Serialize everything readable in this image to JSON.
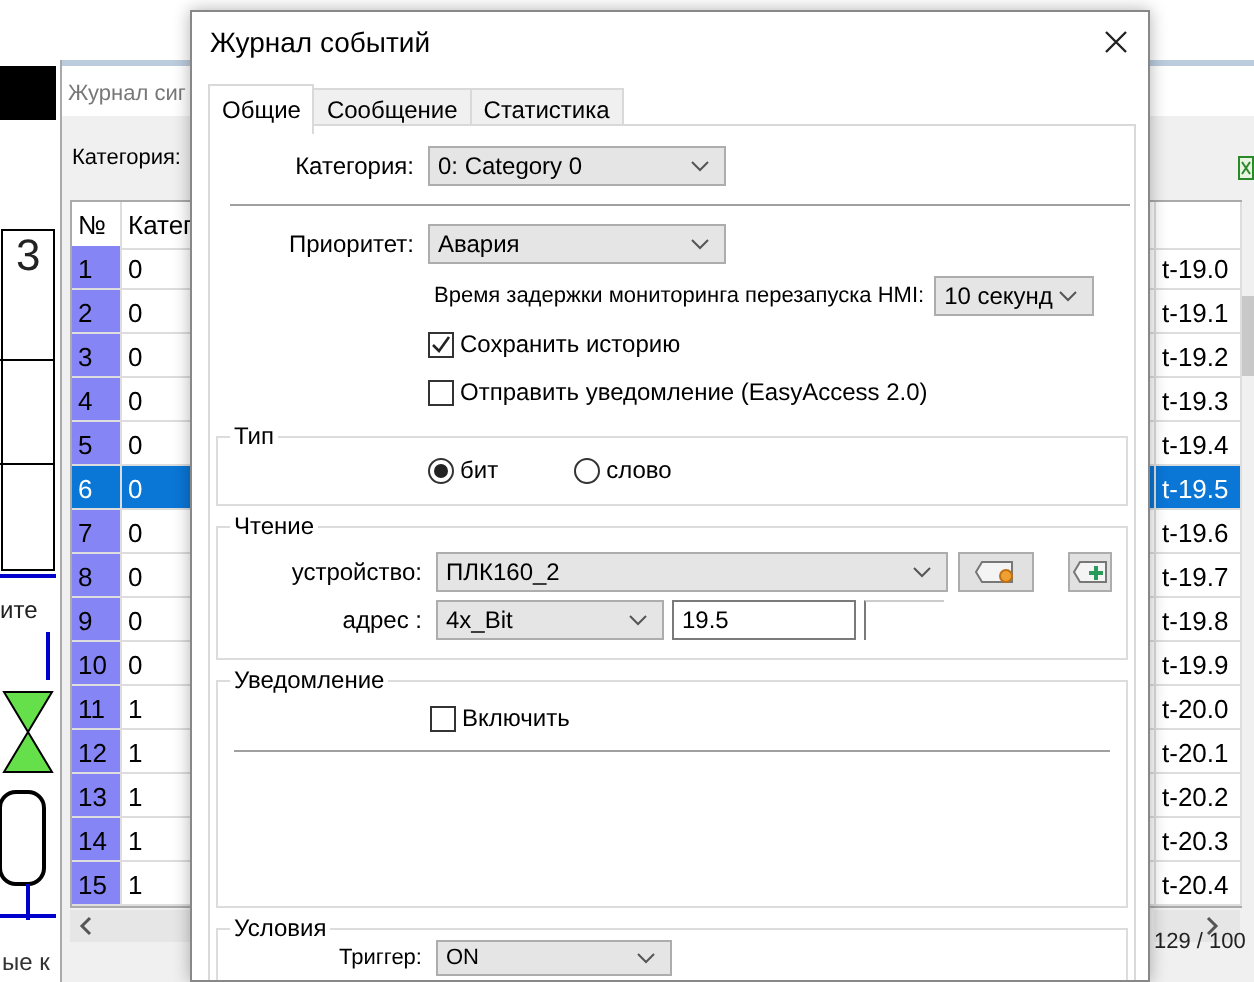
{
  "diagram": {
    "labels": [
      "3",
      "ите"
    ],
    "footer": "ые к"
  },
  "background_window": {
    "title": "Журнал сиг",
    "category_label": "Категория:",
    "table": {
      "columns": [
        "№",
        "Катег"
      ],
      "rows": [
        {
          "number": "1",
          "category": "0",
          "column_3": "t-19.0",
          "selected": false
        },
        {
          "number": "2",
          "category": "0",
          "column_3": "t-19.1",
          "selected": false
        },
        {
          "number": "3",
          "category": "0",
          "column_3": "t-19.2",
          "selected": false
        },
        {
          "number": "4",
          "category": "0",
          "column_3": "t-19.3",
          "selected": false
        },
        {
          "number": "5",
          "category": "0",
          "column_3": "t-19.4",
          "selected": false
        },
        {
          "number": "6",
          "category": "0",
          "column_3": "t-19.5",
          "selected": true
        },
        {
          "number": "7",
          "category": "0",
          "column_3": "t-19.6",
          "selected": false
        },
        {
          "number": "8",
          "category": "0",
          "column_3": "t-19.7",
          "selected": false
        },
        {
          "number": "9",
          "category": "0",
          "column_3": "t-19.8",
          "selected": false
        },
        {
          "number": "10",
          "category": "0",
          "column_3": "t-19.9",
          "selected": false
        },
        {
          "number": "11",
          "category": "1",
          "column_3": "t-20.0",
          "selected": false
        },
        {
          "number": "12",
          "category": "1",
          "column_3": "t-20.1",
          "selected": false
        },
        {
          "number": "13",
          "category": "1",
          "column_3": "t-20.2",
          "selected": false
        },
        {
          "number": "14",
          "category": "1",
          "column_3": "t-20.3",
          "selected": false
        },
        {
          "number": "15",
          "category": "1",
          "column_3": "t-20.4",
          "selected": false
        }
      ]
    },
    "status": "129 / 100"
  },
  "dialog": {
    "title": "Журнал событий",
    "tabs": [
      {
        "label": "Общие",
        "selected": true
      },
      {
        "label": "Сообщение",
        "selected": false
      },
      {
        "label": "Статистика",
        "selected": false
      }
    ],
    "category": {
      "label": "Категория:",
      "value": "0: Category 0"
    },
    "priority": {
      "label": "Приоритет:",
      "value": "Авария"
    },
    "delay": {
      "label": "Время задержки мониторинга перезапуска HMI:",
      "value": "10 секунд"
    },
    "checkboxes": [
      {
        "label": "Сохранить историю",
        "checked": true
      },
      {
        "label": "Отправить уведомление (EasyAccess 2.0)",
        "checked": false
      }
    ],
    "type_group": {
      "title": "Тип",
      "options": [
        {
          "label": "бит",
          "selected": true
        },
        {
          "label": "слово",
          "selected": false
        }
      ]
    },
    "read_group": {
      "title": "Чтение",
      "device_label": "устройство:",
      "device": "ПЛК160_2",
      "address_label": "адрес :",
      "address_type": "4x_Bit",
      "address": "19.5"
    },
    "notify_group": {
      "title": "Уведомление",
      "enable": {
        "label": "Включить",
        "checked": false
      }
    },
    "conditions_group": {
      "title": "Условия",
      "trigger_label": "Триггер:",
      "trigger": "ON"
    }
  }
}
